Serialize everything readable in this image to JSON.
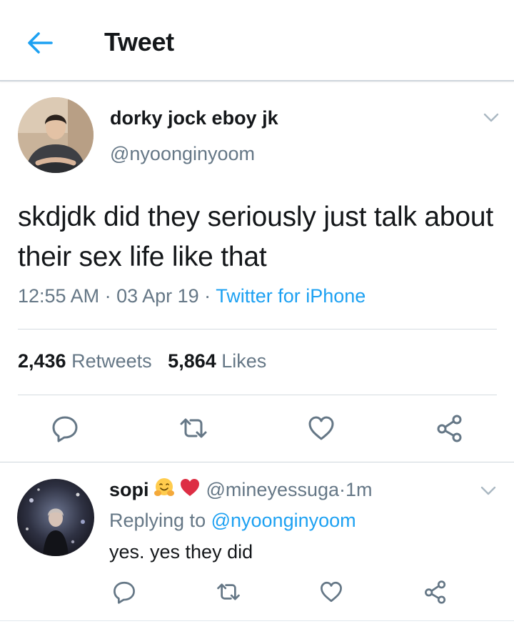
{
  "header": {
    "title": "Tweet",
    "back_icon": "arrow-left-icon"
  },
  "colors": {
    "accent": "#1da1f2",
    "text_primary": "#14171a",
    "text_secondary": "#657786",
    "divider": "#e1e8ed"
  },
  "tweet": {
    "display_name": "dorky jock eboy jk",
    "handle": "@nyoonginyoom",
    "text": "skdjdk did they seriously just talk about their sex life like that",
    "time": "12:55 AM",
    "date": "03 Apr 19",
    "separator": " · ",
    "source": "Twitter for iPhone",
    "retweets_count": "2,436",
    "retweets_label": "Retweets",
    "likes_count": "5,864",
    "likes_label": "Likes"
  },
  "reply": {
    "display_name": "sopi",
    "emojis": [
      "hugging-face-emoji",
      "red-heart-emoji"
    ],
    "handle": "@mineyessuga",
    "separator": " · ",
    "time_ago": "1m",
    "replying_prefix": "Replying to ",
    "replying_to": "@nyoonginyoom",
    "text": "yes. yes they did"
  },
  "actions": [
    "reply-icon",
    "retweet-icon",
    "like-icon",
    "share-icon"
  ]
}
